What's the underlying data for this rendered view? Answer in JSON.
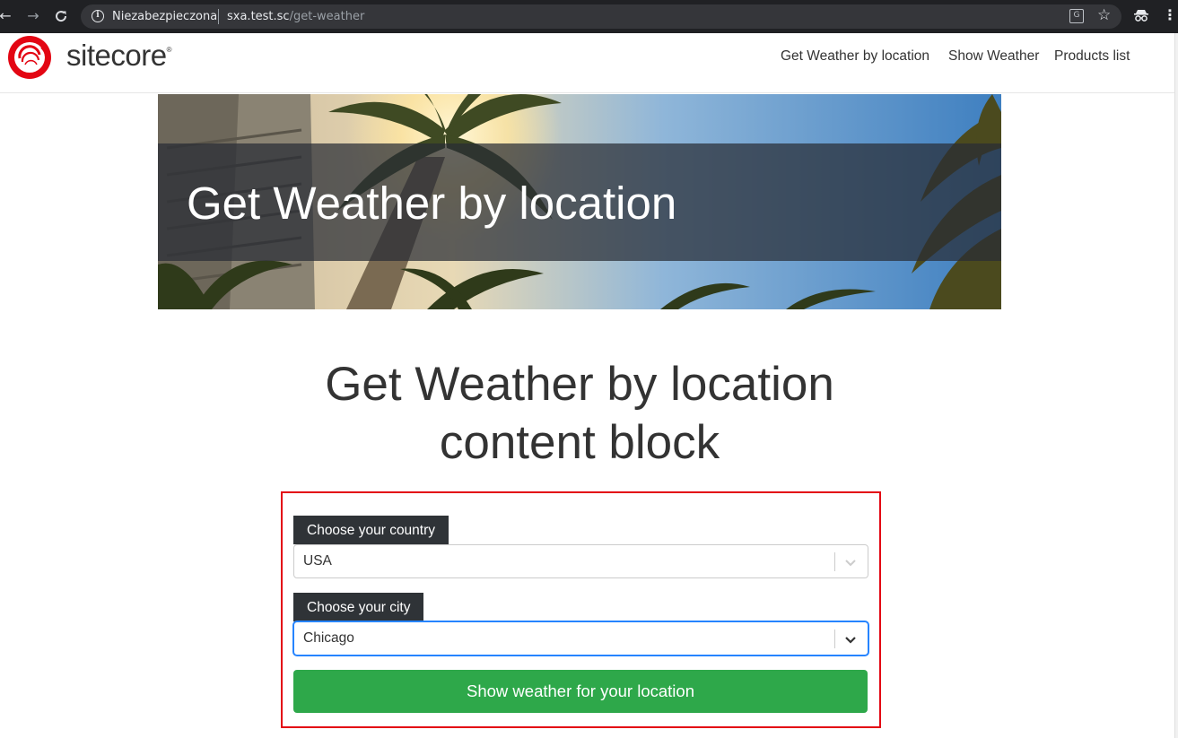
{
  "browser": {
    "security_label": "Niezabezpieczona",
    "url_host": "sxa.test.sc",
    "url_path": "/get-weather"
  },
  "site": {
    "brand": "sitecore",
    "brand_mark": "®",
    "nav": [
      "Get Weather by location",
      "Show Weather",
      "Products list"
    ]
  },
  "hero": {
    "title": "Get Weather by location"
  },
  "content": {
    "title_line1": "Get Weather by location",
    "title_line2": "content block"
  },
  "form": {
    "country_label": "Choose your country",
    "country_value": "USA",
    "city_label": "Choose your city",
    "city_value": "Chicago",
    "submit_label": "Show weather for your location"
  },
  "colors": {
    "brand_red": "#e30613",
    "button_green": "#2ea84a",
    "focus_blue": "#2684ff",
    "label_dark": "#2f3337"
  }
}
